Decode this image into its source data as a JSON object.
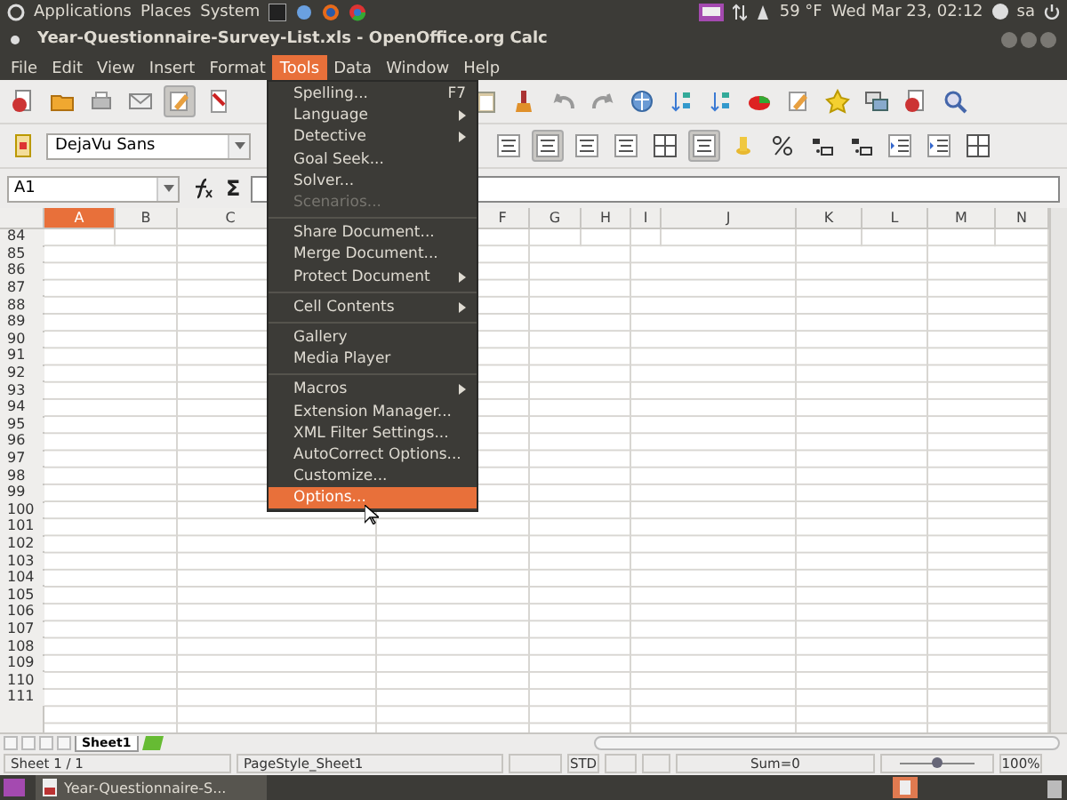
{
  "top_panel": {
    "menus": [
      "Applications",
      "Places",
      "System"
    ],
    "temperature": "59 °F",
    "clock": "Wed Mar 23, 02:12",
    "user": "sa"
  },
  "window": {
    "title": "Year-Questionnaire-Survey-List.xls - OpenOffice.org Calc"
  },
  "menu_bar": [
    {
      "label": "File",
      "selected": false
    },
    {
      "label": "Edit",
      "selected": false
    },
    {
      "label": "View",
      "selected": false
    },
    {
      "label": "Insert",
      "selected": false
    },
    {
      "label": "Format",
      "selected": false
    },
    {
      "label": "Tools",
      "selected": true
    },
    {
      "label": "Data",
      "selected": false
    },
    {
      "label": "Window",
      "selected": false
    },
    {
      "label": "Help",
      "selected": false
    }
  ],
  "font_name": "DejaVu Sans",
  "formula_bar": {
    "name_box": "A1",
    "sum_symbol": "Σ"
  },
  "columns": [
    {
      "label": "A",
      "selected": true
    },
    {
      "label": "B",
      "selected": false
    },
    {
      "label": "C",
      "selected": false
    },
    {
      "label": "F",
      "selected": false
    },
    {
      "label": "G",
      "selected": false
    },
    {
      "label": "H",
      "selected": false
    },
    {
      "label": "I",
      "selected": false
    },
    {
      "label": "J",
      "selected": false
    },
    {
      "label": "K",
      "selected": false
    },
    {
      "label": "L",
      "selected": false
    },
    {
      "label": "M",
      "selected": false
    },
    {
      "label": "N",
      "selected": false
    }
  ],
  "rows": [
    "84",
    "85",
    "86",
    "87",
    "88",
    "89",
    "90",
    "91",
    "92",
    "93",
    "94",
    "95",
    "96",
    "97",
    "98",
    "99",
    "100",
    "101",
    "102",
    "103",
    "104",
    "105",
    "106",
    "107",
    "108",
    "109",
    "110",
    "111"
  ],
  "tools_menu": [
    {
      "kind": "item",
      "label": "Spelling...",
      "shortcut": "F7",
      "submenu": false,
      "disabled": false,
      "selected": false
    },
    {
      "kind": "item",
      "label": "Language",
      "submenu": true,
      "disabled": false,
      "selected": false
    },
    {
      "kind": "item",
      "label": "Detective",
      "submenu": true,
      "disabled": false,
      "selected": false
    },
    {
      "kind": "item",
      "label": "Goal Seek...",
      "submenu": false,
      "disabled": false,
      "selected": false
    },
    {
      "kind": "item",
      "label": "Solver...",
      "submenu": false,
      "disabled": false,
      "selected": false
    },
    {
      "kind": "item",
      "label": "Scenarios...",
      "submenu": false,
      "disabled": true,
      "selected": false
    },
    {
      "kind": "separator"
    },
    {
      "kind": "item",
      "label": "Share Document...",
      "submenu": false,
      "disabled": false,
      "selected": false
    },
    {
      "kind": "item",
      "label": "Merge Document...",
      "submenu": false,
      "disabled": false,
      "selected": false
    },
    {
      "kind": "item",
      "label": "Protect Document",
      "submenu": true,
      "disabled": false,
      "selected": false
    },
    {
      "kind": "separator"
    },
    {
      "kind": "item",
      "label": "Cell Contents",
      "submenu": true,
      "disabled": false,
      "selected": false
    },
    {
      "kind": "separator"
    },
    {
      "kind": "item",
      "label": "Gallery",
      "submenu": false,
      "disabled": false,
      "selected": false
    },
    {
      "kind": "item",
      "label": "Media Player",
      "submenu": false,
      "disabled": false,
      "selected": false
    },
    {
      "kind": "separator"
    },
    {
      "kind": "item",
      "label": "Macros",
      "submenu": true,
      "disabled": false,
      "selected": false
    },
    {
      "kind": "item",
      "label": "Extension Manager...",
      "submenu": false,
      "disabled": false,
      "selected": false
    },
    {
      "kind": "item",
      "label": "XML Filter Settings...",
      "submenu": false,
      "disabled": false,
      "selected": false
    },
    {
      "kind": "item",
      "label": "AutoCorrect Options...",
      "submenu": false,
      "disabled": false,
      "selected": false
    },
    {
      "kind": "item",
      "label": "Customize...",
      "submenu": false,
      "disabled": false,
      "selected": false
    },
    {
      "kind": "item",
      "label": "Options...",
      "submenu": false,
      "disabled": false,
      "selected": true
    }
  ],
  "sheet_tabs": [
    {
      "label": "Sheet1",
      "selected": true
    }
  ],
  "status_bar": {
    "sheet": "Sheet 1 / 1",
    "page_style": "PageStyle_Sheet1",
    "mode": "STD",
    "sum": "Sum=0",
    "zoom": {
      "level": 0.5,
      "reading": "100%"
    }
  },
  "taskbar": [
    {
      "label": "Year-Questionnaire-S...",
      "selected": true
    }
  ]
}
